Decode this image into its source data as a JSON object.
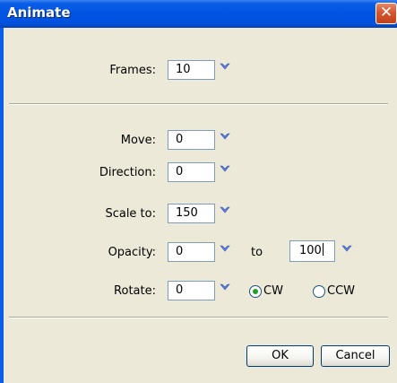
{
  "title": "Animate",
  "close_glyph": "✕",
  "frames": {
    "label": "Frames:",
    "value": "10"
  },
  "move": {
    "label": "Move:",
    "value": "0"
  },
  "direction": {
    "label": "Direction:",
    "value": "0"
  },
  "scale": {
    "label": "Scale to:",
    "value": "150"
  },
  "opacity": {
    "label": "Opacity:",
    "from_value": "0",
    "to_label": "to",
    "to_value": "100"
  },
  "rotate": {
    "label": "Rotate:",
    "value": "0",
    "cw_label": "CW",
    "ccw_label": "CCW",
    "selected": "CW"
  },
  "buttons": {
    "ok": "OK",
    "cancel": "Cancel"
  },
  "colors": {
    "titlebar": "#0054e3",
    "dialog_bg": "#ece9d8",
    "dropdown_arrow": "#5a7bd8",
    "radio_dot": "#21a121"
  },
  "icons": {
    "dropdown": "chevron-down-icon",
    "close": "close-icon"
  }
}
